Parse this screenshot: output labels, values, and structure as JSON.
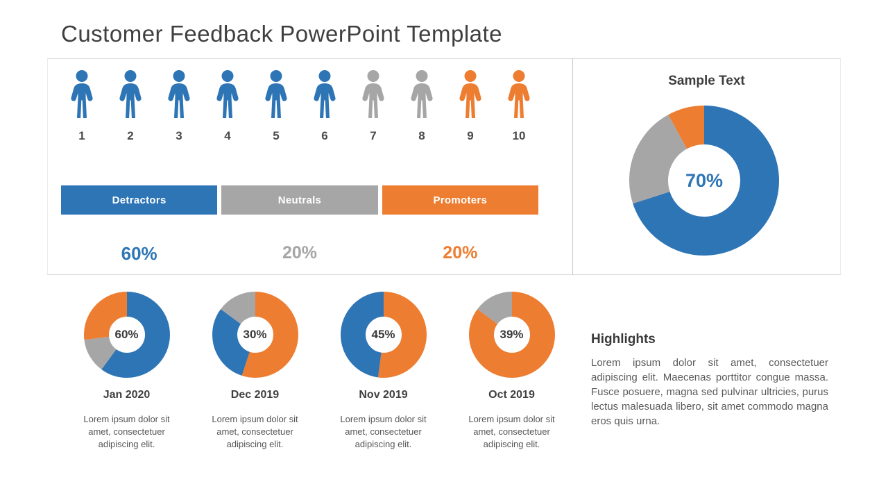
{
  "slide": {
    "title": "Customer Feedback PowerPoint Template",
    "colors": {
      "blue": "#2E75B6",
      "gray": "#A6A6A6",
      "orange": "#ED7D31",
      "text": "#404040"
    }
  },
  "people_scale": {
    "items": [
      {
        "number": "1",
        "color_name": "blue",
        "color": "#2E75B6"
      },
      {
        "number": "2",
        "color_name": "blue",
        "color": "#2E75B6"
      },
      {
        "number": "3",
        "color_name": "blue",
        "color": "#2E75B6"
      },
      {
        "number": "4",
        "color_name": "blue",
        "color": "#2E75B6"
      },
      {
        "number": "5",
        "color_name": "blue",
        "color": "#2E75B6"
      },
      {
        "number": "6",
        "color_name": "blue",
        "color": "#2E75B6"
      },
      {
        "number": "7",
        "color_name": "gray",
        "color": "#A6A6A6"
      },
      {
        "number": "8",
        "color_name": "gray",
        "color": "#A6A6A6"
      },
      {
        "number": "9",
        "color_name": "orange",
        "color": "#ED7D31"
      },
      {
        "number": "10",
        "color_name": "orange",
        "color": "#ED7D31"
      }
    ]
  },
  "segments": [
    {
      "label": "Detractors",
      "percent": "60%",
      "color": "#2E75B6"
    },
    {
      "label": "Neutrals",
      "percent": "20%",
      "color": "#A6A6A6"
    },
    {
      "label": "Promoters",
      "percent": "20%",
      "color": "#ED7D31"
    }
  ],
  "main_chart": {
    "title": "Sample Text",
    "center_label": "70%"
  },
  "monthly": [
    {
      "month": "Jan 2020",
      "center_label": "60%",
      "caption": "Lorem ipsum dolor sit amet, consectetuer adipiscing elit."
    },
    {
      "month": "Dec 2019",
      "center_label": "30%",
      "caption": "Lorem ipsum dolor sit amet, consectetuer adipiscing elit."
    },
    {
      "month": "Nov 2019",
      "center_label": "45%",
      "caption": "Lorem ipsum dolor sit amet, consectetuer adipiscing elit."
    },
    {
      "month": "Oct 2019",
      "center_label": "39%",
      "caption": "Lorem ipsum dolor sit amet, consectetuer adipiscing elit."
    }
  ],
  "highlights": {
    "title": "Highlights",
    "body": "Lorem ipsum dolor sit amet, consectetuer adipiscing elit. Maecenas porttitor congue massa. Fusce posuere, magna sed pulvinar ultricies, purus lectus malesuada libero, sit amet commodo magna eros quis urna."
  },
  "chart_data": [
    {
      "type": "pie",
      "name": "main-donut",
      "title": "Sample Text",
      "center_label": "70%",
      "labels": [
        "Detractors",
        "Neutrals",
        "Promoters"
      ],
      "values": [
        70,
        22,
        8
      ],
      "colors": [
        "#2E75B6",
        "#A6A6A6",
        "#ED7D31"
      ],
      "donut": true,
      "start_angle": 0,
      "legend": "none"
    },
    {
      "type": "pie",
      "name": "donut-jan-2020",
      "title": "Jan 2020",
      "center_label": "60%",
      "labels": [
        "Detractors",
        "Neutrals",
        "Promoters"
      ],
      "values": [
        60,
        13,
        27
      ],
      "colors": [
        "#2E75B6",
        "#A6A6A6",
        "#ED7D31"
      ],
      "donut": true,
      "start_angle": 0,
      "legend": "none"
    },
    {
      "type": "pie",
      "name": "donut-dec-2019",
      "title": "Dec 2019",
      "center_label": "30%",
      "labels": [
        "Promoters",
        "Detractors",
        "Neutrals"
      ],
      "values": [
        55,
        30,
        15
      ],
      "colors": [
        "#ED7D31",
        "#2E75B6",
        "#A6A6A6"
      ],
      "donut": true,
      "start_angle": 0,
      "legend": "none"
    },
    {
      "type": "pie",
      "name": "donut-nov-2019",
      "title": "Nov 2019",
      "center_label": "45%",
      "labels": [
        "Promoters",
        "Detractors"
      ],
      "values": [
        52,
        48
      ],
      "colors": [
        "#ED7D31",
        "#2E75B6"
      ],
      "donut": true,
      "start_angle": 0,
      "legend": "none"
    },
    {
      "type": "pie",
      "name": "donut-oct-2019",
      "title": "Oct 2019",
      "center_label": "39%",
      "labels": [
        "Promoters",
        "Neutrals"
      ],
      "values": [
        85,
        15
      ],
      "colors": [
        "#ED7D31",
        "#A6A6A6"
      ],
      "donut": true,
      "start_angle": 0,
      "legend": "none"
    },
    {
      "type": "bar",
      "name": "nps-segments",
      "categories": [
        "Detractors",
        "Neutrals",
        "Promoters"
      ],
      "values": [
        60,
        20,
        20
      ],
      "colors": [
        "#2E75B6",
        "#A6A6A6",
        "#ED7D31"
      ],
      "ylabel": "",
      "xlabel": ""
    }
  ]
}
